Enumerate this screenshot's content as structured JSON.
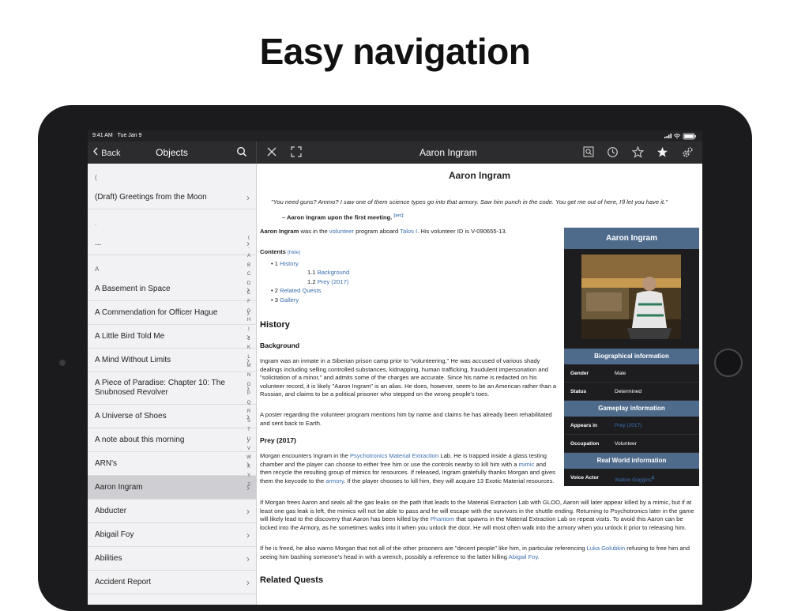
{
  "headline": "Easy navigation",
  "status_bar": {
    "time": "9:41 AM",
    "date": "Tue Jan 9"
  },
  "sidebar": {
    "back_label": "Back",
    "title": "Objects",
    "sections": [
      {
        "header": "(",
        "items": [
          "(Draft) Greetings from the Moon"
        ]
      },
      {
        "header": ".",
        "items": [
          "..."
        ]
      },
      {
        "header": "A",
        "items": [
          "A Basement in Space",
          "A Commendation for Officer Hague",
          "A Little Bird Told Me",
          "A Mind Without Limits",
          "A Piece of Paradise: Chapter 10: The Snubnosed Revolver",
          "A Universe of Shoes",
          "A note about this morning",
          "ARN's",
          "Aaron Ingram",
          "Abducter",
          "Abigail Foy",
          "Abilities",
          "Accident Report"
        ]
      }
    ],
    "selected": "Aaron Ingram",
    "index_letters": [
      "(",
      ".",
      "A",
      "B",
      "C",
      "D",
      "E",
      "F",
      "G",
      "H",
      "I",
      "J",
      "K",
      "L",
      "M",
      "N",
      "O",
      "P",
      "Q",
      "R",
      "S",
      "T",
      "U",
      "V",
      "W",
      "X",
      "Y",
      "Z"
    ]
  },
  "article": {
    "toolbar_title": "Aaron Ingram",
    "title": "Aaron Ingram",
    "quote": "\"You need guns? Ammo? I saw one of them science types go into that armory. Saw him punch in the code. You get me out of here, I'll let you have it.\"",
    "quote_by": "– Aaron Ingram upon the first meeting.",
    "src": "[src]",
    "intro": {
      "name": "Aaron Ingram",
      "t1": " was in the ",
      "l1": "volunteer",
      "t2": " program aboard ",
      "l2": "Talos I",
      "t3": ". His volunteer ID is V-090655-13."
    },
    "toc": {
      "label": "Contents",
      "hide": "[hide]",
      "entries": [
        {
          "num": "1",
          "label": "History"
        },
        {
          "num": "1.1",
          "label": "Background"
        },
        {
          "num": "1.2",
          "label": "Prey (2017)"
        },
        {
          "num": "2",
          "label": "Related Quests"
        },
        {
          "num": "3",
          "label": "Gallery"
        }
      ]
    },
    "history_heading": "History",
    "background_heading": "Background",
    "background_p1": "Ingram was an inmate in a Siberian prison camp prior to \"volunteering,\" He was accused of various shady dealings including selling controlled substances, kidnapping, human trafficking, fraudulent impersonation and \"solicitation of a minor,\" and admits some of the charges are accurate. Since his name is redacted on his volunteer record, it is likely \"Aaron Ingram\" is an alias. He does, however, seem to be an American rather than a Russian, and claims to be a political prisoner who stepped on the wrong people's toes.",
    "background_p2": "A poster regarding the volunteer program mentions him by name and claims he has already been rehabilitated and sent back to Earth.",
    "prey_heading": "Prey (2017)",
    "prey_p1": {
      "t1": "Morgan encounters Ingram in the ",
      "l1": "Psychotronics Material Extraction",
      "t2": " Lab. He is trapped inside a glass testing chamber and the player can choose to either free him or use the controls nearby to kill him with a ",
      "l2": "mimic",
      "t3": " and then recycle the resulting group of mimics for resources. If released, Ingram gratefully thanks Morgan and gives them the keycode to the ",
      "l3": "armory",
      "t4": ". If the player chooses to kill him, they will acquire 13 Exotic Material resources."
    },
    "prey_p2": {
      "t1": "If Morgan frees Aaron and seals all the gas leaks on the path that leads to the Material Extraction Lab with GLOO, Aaron will later appear killed by a mimic, but if at least one gas leak is left, the mimics will not be able to pass and he will escape with the survivors in the shuttle ending. Returning to Psychotronics later in the game will likely lead to the discovery that Aaron has been killed by the ",
      "l1": "Phantom",
      "t2": " that spawns in the Material Extraction Lab on repeat visits. To avoid this Aaron can be locked into the Armory, as he sometimes walks into it when you unlock the door. He will most often walk into the armory when you unlock it prior to releasing him."
    },
    "prey_p3": {
      "t1": "If he is freed, he also warns Morgan that not all of the other prisoners are \"decent people\" like him, in particular referencing ",
      "l1": "Luka Golubkin",
      "t2": " refusing to free him and seeing him bashing someone's head in with a wrench, possibly a reference to the latter killing ",
      "l2": "Abigail Foy",
      "t3": "."
    },
    "related_heading": "Related Quests"
  },
  "infobox": {
    "title": "Aaron Ingram",
    "bio_header": "Biographical information",
    "gender_label": "Gender",
    "gender_value": "Male",
    "status_label": "Status",
    "status_value": "Determined",
    "gameplay_header": "Gameplay information",
    "appears_label": "Appears in",
    "appears_value": "Prey (2017)",
    "occupation_label": "Occupation",
    "occupation_value": "Volunteer",
    "realworld_header": "Real World information",
    "voice_label": "Voice Actor",
    "voice_value": "Walton Goggins"
  },
  "colors": {
    "toolbar": "#2c2c2e",
    "link": "#3a6fb0",
    "infobox_header": "#4f6b8c",
    "infobox_bg": "#1d1d1f",
    "sidebar_bg": "#f2f2f4",
    "selected_row": "#cfcfd3"
  },
  "icons": [
    "back-chevron-icon",
    "search-icon",
    "close-icon",
    "fullscreen-icon",
    "find-in-page-icon",
    "history-icon",
    "star-outline-icon",
    "star-filled-icon",
    "settings-gear-icon",
    "chevron-right-icon",
    "external-link-icon"
  ]
}
